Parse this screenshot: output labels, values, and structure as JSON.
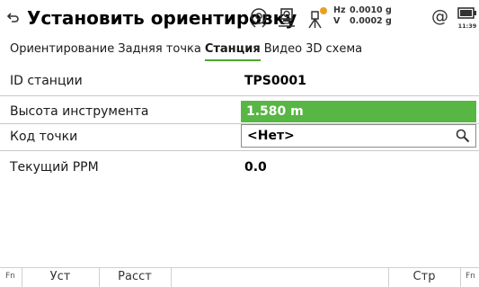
{
  "header": {
    "title": "Установить ориентировку",
    "tilt": {
      "hz_label": "Hz",
      "hz_value": "0.0010 g",
      "v_label": "V",
      "v_value": "0.0002 g"
    },
    "at_symbol": "@",
    "clock": "11:39"
  },
  "tabs": [
    {
      "label": "Ориентирование",
      "active": false
    },
    {
      "label": "Задняя точка",
      "active": false
    },
    {
      "label": "Станция",
      "active": true
    },
    {
      "label": "Видео",
      "active": false
    },
    {
      "label": "3D схема",
      "active": false
    }
  ],
  "fields": {
    "station_id": {
      "label": "ID станции",
      "value": "TPS0001"
    },
    "instrument_height": {
      "label": "Высота инструмента",
      "value": "1.580 m"
    },
    "point_code": {
      "label": "Код точки",
      "value": "<Нет>"
    },
    "current_ppm": {
      "label": "Текущий PPM",
      "value": "0.0"
    }
  },
  "softkeys": {
    "fn_left": "Fn",
    "key1": "Уст",
    "key2": "Расст",
    "key_right": "Стр",
    "fn_right": "Fn"
  },
  "colors": {
    "accent_green": "#58b644",
    "tab_underline": "#4aa832"
  }
}
